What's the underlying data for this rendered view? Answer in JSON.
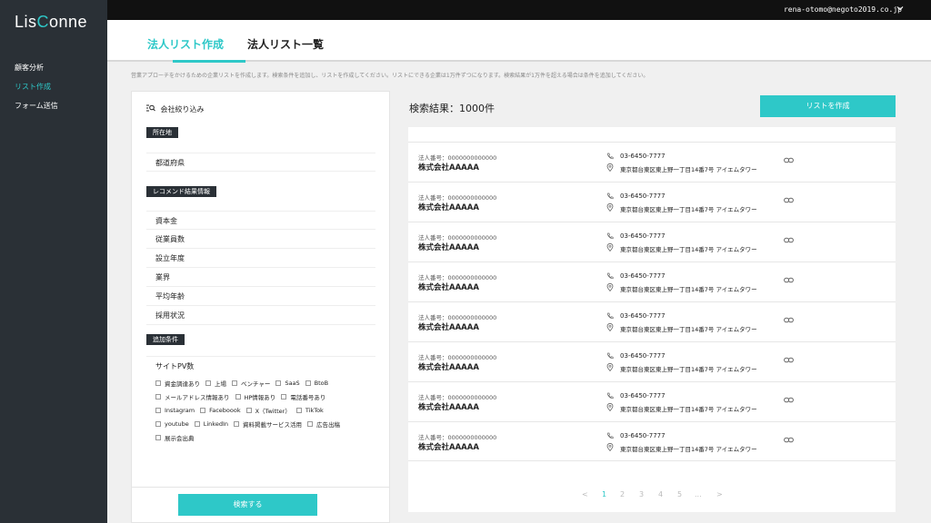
{
  "app": {
    "logo_prefix": "Lis",
    "logo_c": "C",
    "logo_suffix": "onne"
  },
  "sidebar": {
    "items": [
      {
        "label": "顧客分析",
        "active": false
      },
      {
        "label": "リスト作成",
        "active": true
      },
      {
        "label": "フォーム送信",
        "active": false
      }
    ]
  },
  "topbar": {
    "user_email": "rena-otomo@negoto2019.co.jp",
    "chevron_icon": "chevron-down-icon"
  },
  "tabs": [
    {
      "label": "法人リスト作成",
      "active": true
    },
    {
      "label": "法人リスト一覧",
      "active": false
    }
  ],
  "description": "営業アプローチをかけるための企業リストを作成します。検索条件を追加し、リストを作成してください。リストにできる企業は1万件ずつになります。検索結果が1万件を超える場合は条件を追加してください。",
  "filter": {
    "title": "会社絞り込み",
    "title_icon": "filter-search-icon",
    "location_tag": "所在地",
    "prefecture": "都道府県",
    "recommend_tag": "レコメンド結果情報",
    "recommend_rows": [
      "資本金",
      "従業員数",
      "設立年度",
      "業界",
      "平均年齢",
      "採用状況"
    ],
    "extra_tag": "追加条件",
    "site_pv": "サイトPV数",
    "checkbox_lines": [
      [
        "資金調達あり",
        "上場",
        "ベンチャー",
        "SaaS",
        "BtoB"
      ],
      [
        "メールアドレス情報あり",
        "HP情報あり",
        "電話番号あり"
      ],
      [
        "Instagram",
        "Faceboook",
        "X（Twitter）",
        "TikTok"
      ],
      [
        "youtube",
        "LinkedIn",
        "資料掲載サービス活用",
        "広告出稿"
      ],
      [
        "展示会出典"
      ]
    ],
    "search_button": "検索する"
  },
  "results": {
    "title": "検索結果：1000件",
    "create_button": "リストを作成",
    "rows": [
      {
        "corp_no": "法人番号：0000000000000",
        "name": "株式会社AAAAA",
        "phone": "03-6450-7777",
        "address": "東京都台東区東上野一丁目14番7号 アイエムタワー"
      },
      {
        "corp_no": "法人番号：0000000000000",
        "name": "株式会社AAAAA",
        "phone": "03-6450-7777",
        "address": "東京都台東区東上野一丁目14番7号 アイエムタワー"
      },
      {
        "corp_no": "法人番号：0000000000000",
        "name": "株式会社AAAAA",
        "phone": "03-6450-7777",
        "address": "東京都台東区東上野一丁目14番7号 アイエムタワー"
      },
      {
        "corp_no": "法人番号：0000000000000",
        "name": "株式会社AAAAA",
        "phone": "03-6450-7777",
        "address": "東京都台東区東上野一丁目14番7号 アイエムタワー"
      },
      {
        "corp_no": "法人番号：0000000000000",
        "name": "株式会社AAAAA",
        "phone": "03-6450-7777",
        "address": "東京都台東区東上野一丁目14番7号 アイエムタワー"
      },
      {
        "corp_no": "法人番号：0000000000000",
        "name": "株式会社AAAAA",
        "phone": "03-6450-7777",
        "address": "東京都台東区東上野一丁目14番7号 アイエムタワー"
      },
      {
        "corp_no": "法人番号：0000000000000",
        "name": "株式会社AAAAA",
        "phone": "03-6450-7777",
        "address": "東京都台東区東上野一丁目14番7号 アイエムタワー"
      },
      {
        "corp_no": "法人番号：0000000000000",
        "name": "株式会社AAAAA",
        "phone": "03-6450-7777",
        "address": "東京都台東区東上野一丁目14番7号 アイエムタワー"
      }
    ]
  },
  "pagination": {
    "prev": "<",
    "pages": [
      "1",
      "2",
      "3",
      "4",
      "5",
      "..."
    ],
    "next": ">",
    "current": "1"
  },
  "colors": {
    "accent": "#2ec8c8",
    "sidebar_bg": "#2a3036",
    "topbar_bg": "#111111"
  }
}
